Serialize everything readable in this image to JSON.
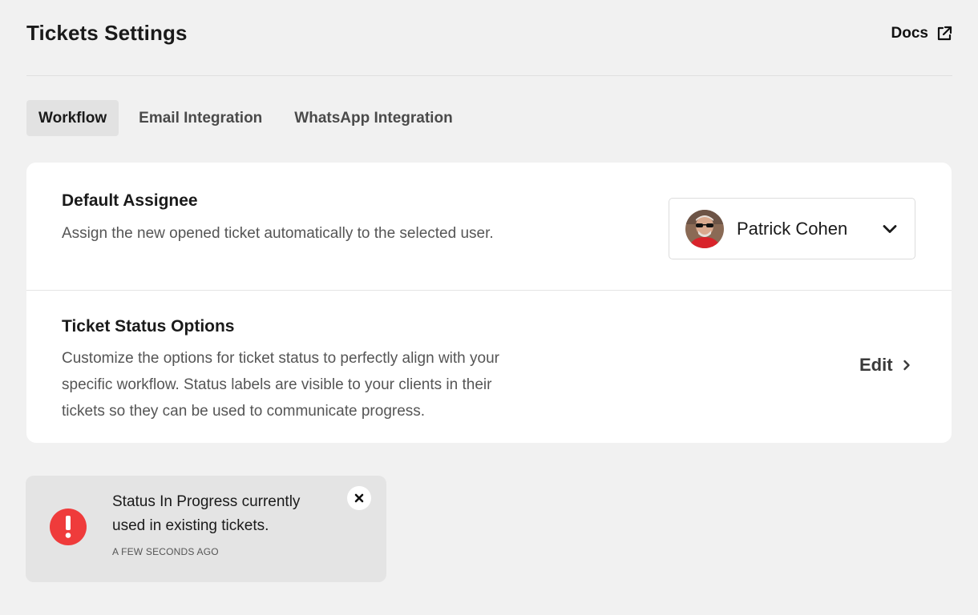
{
  "header": {
    "title": "Tickets Settings",
    "docs_label": "Docs",
    "docs_icon": "external-link-icon"
  },
  "tabs": [
    {
      "label": "Workflow",
      "active": true
    },
    {
      "label": "Email Integration",
      "active": false
    },
    {
      "label": "WhatsApp Integration",
      "active": false
    }
  ],
  "settings": {
    "default_assignee": {
      "title": "Default Assignee",
      "description": "Assign the new opened ticket automatically to the selected user.",
      "selected_user": "Patrick Cohen",
      "dropdown_icon": "chevron-down-icon"
    },
    "ticket_status": {
      "title": "Ticket Status Options",
      "description": "Customize the options for ticket status to perfectly align with your specific workflow. Status labels are visible to your clients in their tickets so they can be used to communicate progress.",
      "action_label": "Edit",
      "action_icon": "chevron-right-icon"
    }
  },
  "toast": {
    "message": "Status In Progress currently used in existing tickets.",
    "time": "A FEW SECONDS AGO",
    "icon": "error-icon",
    "close_icon": "close-icon",
    "accent_color": "#ef3b3b"
  }
}
